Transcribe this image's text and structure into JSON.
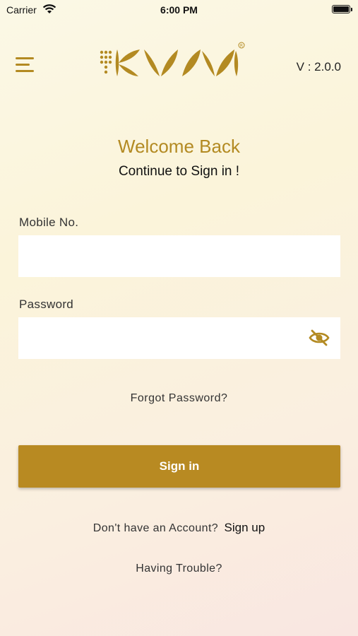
{
  "status_bar": {
    "carrier": "Carrier",
    "time": "6:00 PM"
  },
  "header": {
    "version": "V : 2.0.0",
    "brand_color": "#b38a22"
  },
  "login": {
    "welcome": "Welcome Back",
    "subtitle": "Continue to Sign in !",
    "mobile_label": "Mobile No.",
    "mobile_value": "",
    "password_label": "Password",
    "password_value": "",
    "forgot_label": "Forgot Password?",
    "signin_label": "Sign in",
    "no_account_text": "Don't have an Account?",
    "signup_label": "Sign up",
    "trouble_label": "Having Trouble?"
  },
  "icons": [
    "wifi-icon",
    "battery-icon",
    "menu-icon",
    "eye-off-icon"
  ],
  "colors": {
    "accent": "#b88a22",
    "field_bg": "#ffffff"
  }
}
